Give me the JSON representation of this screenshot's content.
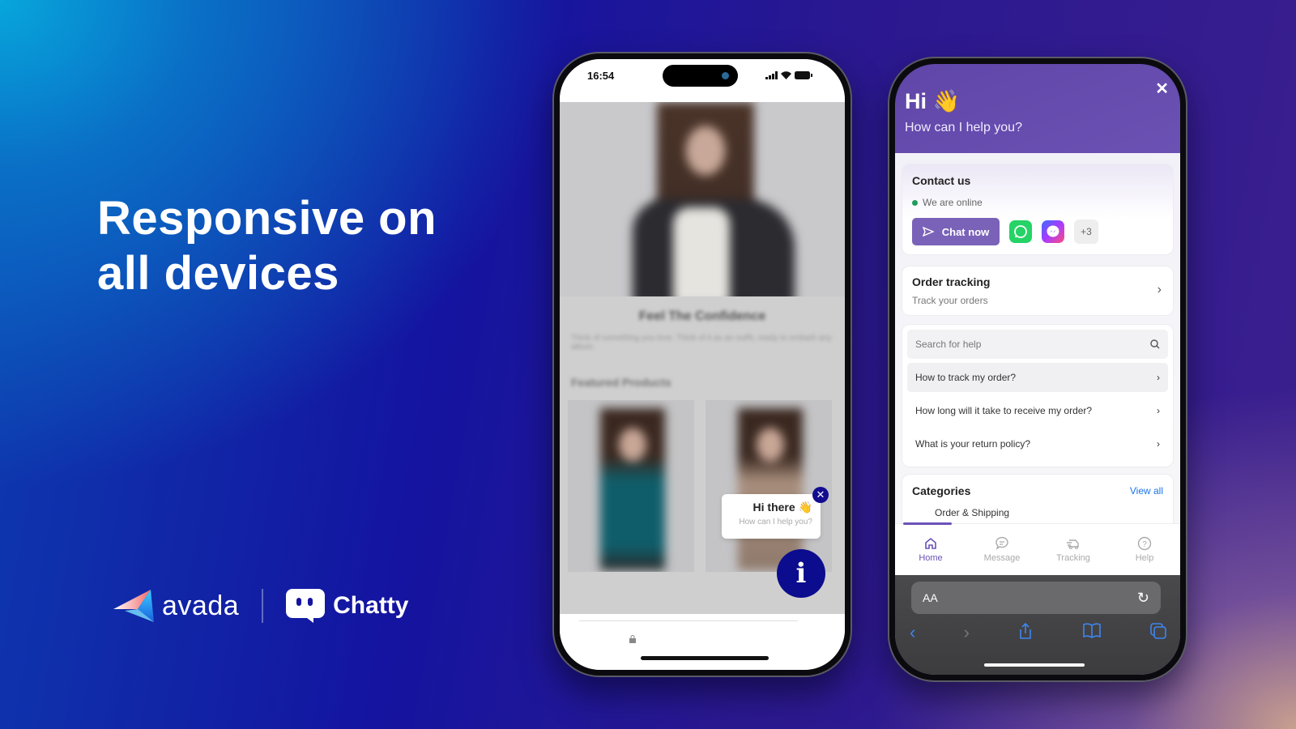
{
  "headline": {
    "line1": "Responsive on",
    "line2": "all devices"
  },
  "brands": {
    "avada": "avada",
    "chatty": "Chatty"
  },
  "phone1": {
    "status_time": "16:54",
    "store_title": "Feel The Confidence",
    "store_desc": "Think of something you love. Think of it as an outfit, ready to embark any album",
    "featured": "Featured Products",
    "bubble_title": "Hi there 👋",
    "bubble_sub": "How can I help you?",
    "accent": "#0c0c8e"
  },
  "phone2": {
    "greeting": "Hi 👋",
    "subtitle": "How can I help you?",
    "contact": {
      "title": "Contact us",
      "status": "We are online",
      "chat_now": "Chat now",
      "more": "+3"
    },
    "order": {
      "title": "Order tracking",
      "subtitle": "Track your orders"
    },
    "search_placeholder": "Search for help",
    "faqs": [
      "How to track my order?",
      "How long will it take to receive my order?",
      "What is your return policy?"
    ],
    "categories": {
      "title": "Categories",
      "view_all": "View all",
      "first": "Order & Shipping"
    },
    "tabs": [
      {
        "label": "Home",
        "active": true
      },
      {
        "label": "Message"
      },
      {
        "label": "Tracking"
      },
      {
        "label": "Help"
      }
    ],
    "address_bar": "AA",
    "accent": "#6b52b8"
  }
}
